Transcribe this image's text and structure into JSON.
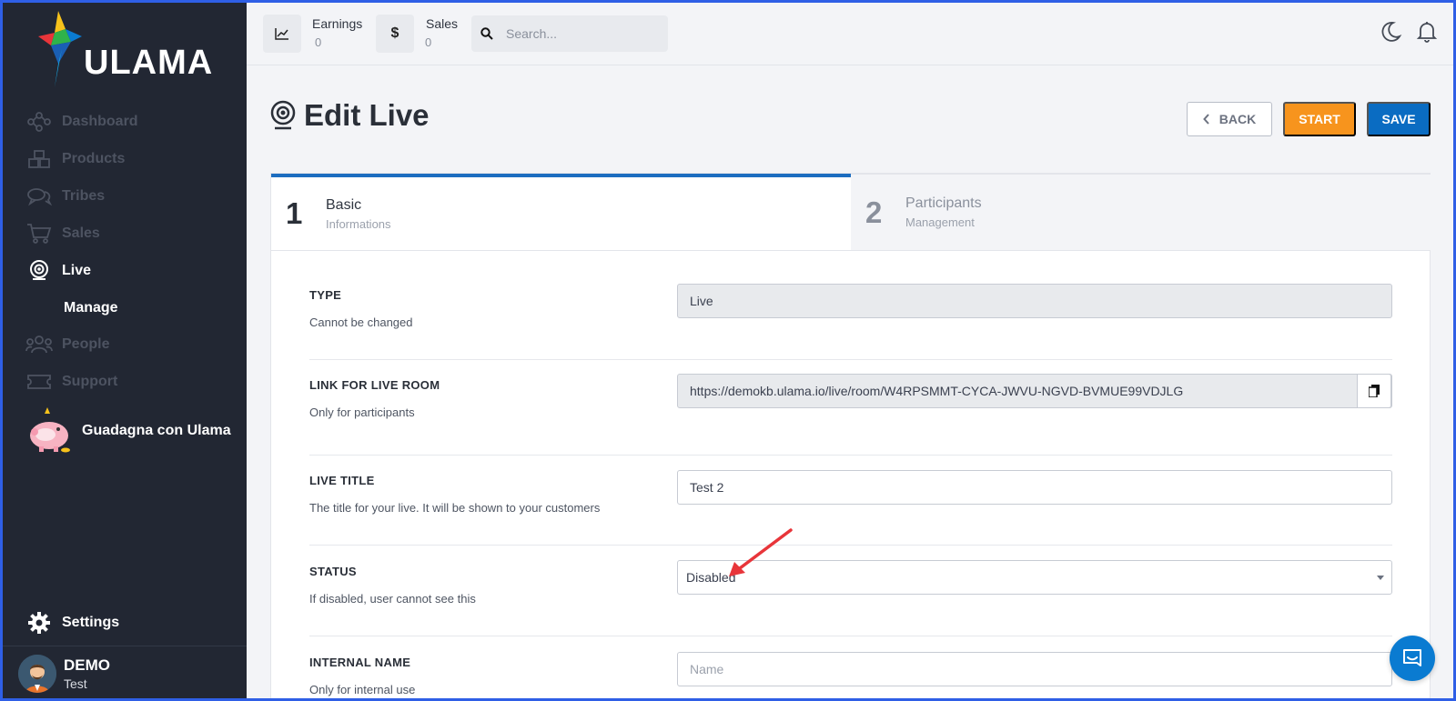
{
  "brand": {
    "name": "ULAMA"
  },
  "sidebar": {
    "items": [
      {
        "label": "Dashboard",
        "icon": "network-icon"
      },
      {
        "label": "Products",
        "icon": "boxes-icon"
      },
      {
        "label": "Tribes",
        "icon": "chat-icon"
      },
      {
        "label": "Sales",
        "icon": "cart-icon"
      },
      {
        "label": "Live",
        "icon": "webcam-icon",
        "active": true
      },
      {
        "label": "Manage",
        "sub": true
      },
      {
        "label": "People",
        "icon": "people-icon"
      },
      {
        "label": "Support",
        "icon": "ticket-icon"
      }
    ],
    "promo_label": "Guadagna con Ulama",
    "settings_label": "Settings",
    "user": {
      "name": "DEMO",
      "role": "Test"
    }
  },
  "topbar": {
    "earnings_label": "Earnings",
    "earnings_value": "0",
    "sales_label": "Sales",
    "sales_value": "0",
    "sales_symbol": "$",
    "search_placeholder": "Search..."
  },
  "header": {
    "title": "Edit Live",
    "back_label": "BACK",
    "start_label": "START",
    "save_label": "SAVE"
  },
  "steps": [
    {
      "num": "1",
      "title": "Basic",
      "sub": "Informations",
      "active": true
    },
    {
      "num": "2",
      "title": "Participants",
      "sub": "Management",
      "active": false
    }
  ],
  "form": {
    "type": {
      "label": "TYPE",
      "help": "Cannot be changed",
      "value": "Live"
    },
    "link": {
      "label": "LINK FOR LIVE ROOM",
      "help": "Only for participants",
      "value": "https://demokb.ulama.io/live/room/W4RPSMMT-CYCA-JWVU-NGVD-BVMUE99VDJLG"
    },
    "title": {
      "label": "LIVE TITLE",
      "help": "The title for your live. It will be shown to your customers",
      "value": "Test 2"
    },
    "status": {
      "label": "STATUS",
      "help": "If disabled, user cannot see this",
      "value": "Disabled"
    },
    "internal": {
      "label": "INTERNAL NAME",
      "help": "Only for internal use",
      "placeholder": "Name"
    }
  },
  "colors": {
    "sidebar_bg": "#222733",
    "accent_blue": "#0a6cc2",
    "start_orange": "#f7941d",
    "annotation_red": "#e8353a"
  }
}
